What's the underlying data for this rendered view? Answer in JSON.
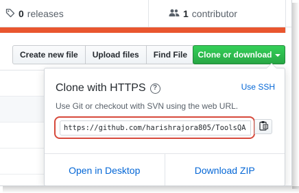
{
  "summary": {
    "releases_count": "0",
    "releases_label": "releases",
    "contributors_count": "1",
    "contributors_label": "contributor"
  },
  "toolbar": {
    "create_new_file": "Create new file",
    "upload_files": "Upload files",
    "find_file": "Find File",
    "clone_or_download": "Clone or download"
  },
  "clone_popover": {
    "title": "Clone with HTTPS",
    "use_ssh": "Use SSH",
    "description": "Use Git or checkout with SVN using the web URL.",
    "url": "https://github.com/harishrajora805/ToolsQA",
    "open_in_desktop": "Open in Desktop",
    "download_zip": "Download ZIP"
  },
  "colors": {
    "accent_green": "#28a745",
    "link_blue": "#0366d6",
    "language_bar_orange": "#e9562f",
    "highlight_red": "#d6483a"
  }
}
